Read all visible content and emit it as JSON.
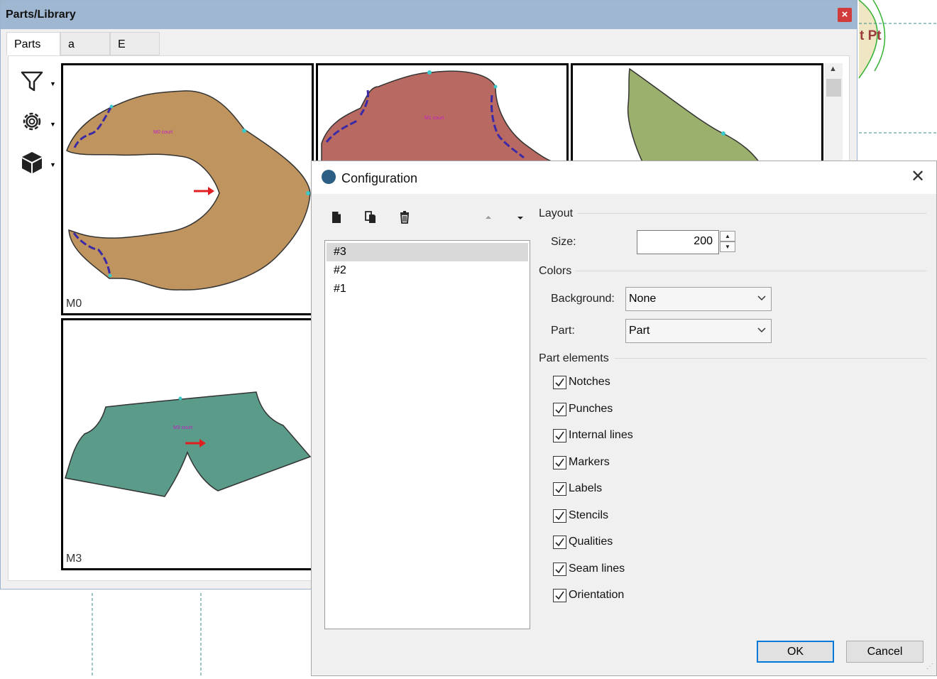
{
  "background": {
    "label_fragment": "t Pt"
  },
  "library": {
    "title": "Parts/Library",
    "close_glyph": "×",
    "tabs": [
      {
        "label": "Parts"
      },
      {
        "label": "a"
      },
      {
        "label": "E"
      }
    ],
    "tools": [
      {
        "icon": "filter-icon"
      },
      {
        "icon": "gear-icon"
      },
      {
        "icon": "cube-icon"
      }
    ],
    "parts": [
      {
        "label": "M0",
        "color": "#bf945e"
      },
      {
        "label": "",
        "color": "#b86a62"
      },
      {
        "label": "",
        "color": "#9bb06c"
      },
      {
        "label": "M3",
        "color": "#5a9b8a"
      }
    ]
  },
  "config": {
    "title": "Configuration",
    "close_glyph": "✕",
    "toolbar": [
      {
        "icon": "new-icon"
      },
      {
        "icon": "copy-icon"
      },
      {
        "icon": "delete-icon"
      },
      {
        "icon": "move-up-icon"
      },
      {
        "icon": "move-down-icon"
      }
    ],
    "list": [
      "#3",
      "#2",
      "#1"
    ],
    "selected_index": 0,
    "layout": {
      "title": "Layout",
      "size_label": "Size:",
      "size_value": "200"
    },
    "colors": {
      "title": "Colors",
      "background_label": "Background:",
      "background_value": "None",
      "part_label": "Part:",
      "part_value": "Part"
    },
    "part_elements": {
      "title": "Part elements",
      "items": [
        {
          "label": "Notches",
          "checked": true
        },
        {
          "label": "Punches",
          "checked": true
        },
        {
          "label": "Internal lines",
          "checked": true
        },
        {
          "label": "Markers",
          "checked": true
        },
        {
          "label": "Labels",
          "checked": true
        },
        {
          "label": "Stencils",
          "checked": true
        },
        {
          "label": "Qualities",
          "checked": true
        },
        {
          "label": "Seam lines",
          "checked": true
        },
        {
          "label": "Orientation",
          "checked": true
        }
      ]
    },
    "ok_label": "OK",
    "cancel_label": "Cancel"
  }
}
